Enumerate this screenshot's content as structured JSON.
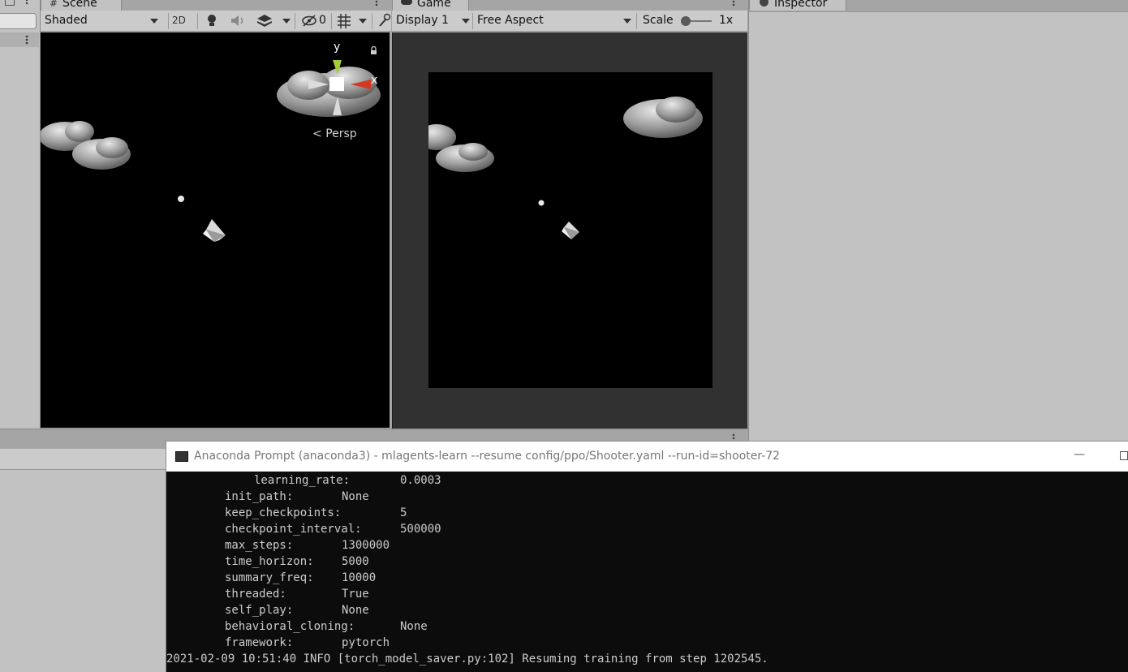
{
  "scene": {
    "tab_label": "Scene",
    "shading_mode": "Shaded",
    "mode_2d": "2D",
    "hidden_count": "0",
    "persp_label": "Persp",
    "axis_y": "y",
    "axis_x": "x"
  },
  "game": {
    "tab_label": "Game",
    "display": "Display 1",
    "aspect": "Free Aspect",
    "scale_label": "Scale",
    "scale_value": "1x",
    "scale_level": 0.0
  },
  "inspector": {
    "tab_label": "Inspector"
  },
  "console": {
    "title": "Anaconda Prompt (anaconda3) - mlagents-learn  --resume config/ppo/Shooter.yaml --run-id=shooter-72",
    "minimize": "—",
    "lines": [
      {
        "key": "learning_rate:",
        "value": "0.0003"
      },
      {
        "key": "init_path:",
        "value": "None"
      },
      {
        "key": "keep_checkpoints:",
        "value": "5"
      },
      {
        "key": "checkpoint_interval:",
        "value": "500000"
      },
      {
        "key": "max_steps:",
        "value": "1300000"
      },
      {
        "key": "time_horizon:",
        "value": "5000"
      },
      {
        "key": "summary_freq:",
        "value": "10000"
      },
      {
        "key": "threaded:",
        "value": "True"
      },
      {
        "key": "self_play:",
        "value": "None"
      },
      {
        "key": "behavioral_cloning:",
        "value": "None"
      },
      {
        "key": "framework:",
        "value": "pytorch"
      }
    ],
    "log_line": "2021-02-09 10:51:40 INFO [torch_model_saver.py:102] Resuming training from step 1202545."
  }
}
